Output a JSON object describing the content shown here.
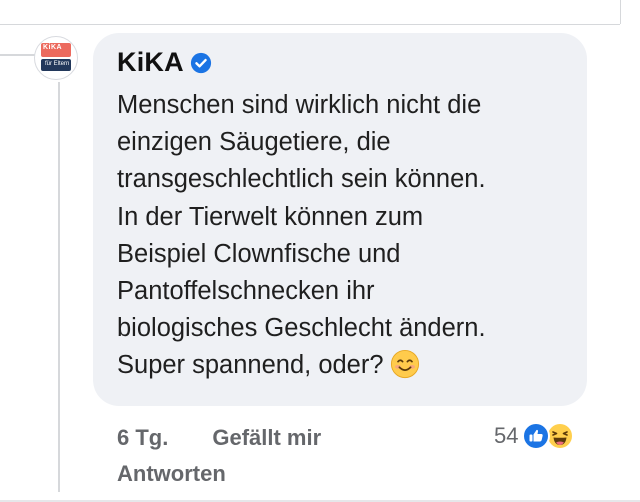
{
  "avatar": {
    "logo_text": "KiKA",
    "sub_text": "für Eltern"
  },
  "comment": {
    "author": "KiKA",
    "lines": [
      "Menschen sind wirklich nicht die",
      "einzigen Säugetiere, die",
      "transgeschlechtlich sein können.",
      "In der Tierwelt können zum",
      "Beispiel Clownfische und",
      "Pantoffelschnecken ihr",
      "biologisches Geschlecht ändern.",
      "Super spannend, oder?"
    ]
  },
  "meta": {
    "time": "6 Tg.",
    "like_label": "Gefällt mir",
    "reply_label": "Antworten",
    "reaction_count": "54"
  },
  "icons": {
    "verified": "verified-badge-icon",
    "smile": "smiling-face-emoji-icon",
    "like": "like-reaction-icon",
    "haha": "haha-reaction-icon"
  },
  "colors": {
    "verified_blue": "#1b74e4",
    "bubble_bg": "#eff1f5",
    "meta_gray": "#65676b"
  }
}
